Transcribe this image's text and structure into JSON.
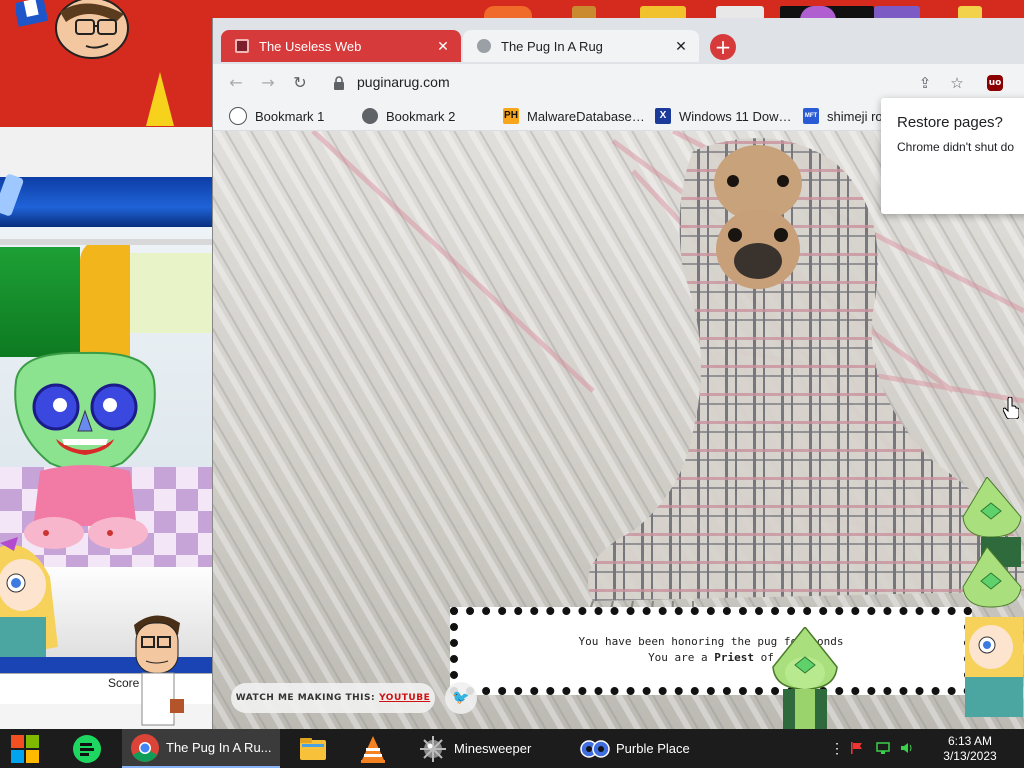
{
  "browser": {
    "tabs": [
      {
        "title": "The Useless Web",
        "active": false
      },
      {
        "title": "The Pug In A Rug",
        "active": true
      }
    ],
    "new_tab_symbol": "+",
    "url": "puginarug.com",
    "bookmarks": [
      {
        "label": "Bookmark 1",
        "icon": "ghost-icon"
      },
      {
        "label": "Bookmark 2",
        "icon": "globe-icon"
      },
      {
        "label": "MalwareDatabase…",
        "icon": "ph-icon",
        "icon_text": "PH"
      },
      {
        "label": "Windows 11 Dow…",
        "icon": "x-icon",
        "icon_text": "X"
      },
      {
        "label": "shimeji ro…",
        "icon": "mft-icon",
        "icon_text": "MFT"
      }
    ],
    "restore_popup": {
      "title": "Restore pages?",
      "body": "Chrome didn't shut do"
    }
  },
  "page": {
    "honor_line1": "You have been honoring the pug fo      econds",
    "honor_line2_prefix": "You are a ",
    "honor_rank": "Priest",
    "honor_line2_suffix": " of",
    "watch_label": "WATCH ME MAKING THIS:",
    "watch_link": "YOUTUBE"
  },
  "game": {
    "score_label": "Score"
  },
  "taskbar": {
    "items": [
      {
        "label": "",
        "icon": "windows-start-icon"
      },
      {
        "label": "",
        "icon": "green-app-icon"
      },
      {
        "label": "The Pug In A Ru...",
        "icon": "chrome-icon",
        "active": true
      },
      {
        "label": "",
        "icon": "file-explorer-icon"
      },
      {
        "label": "",
        "icon": "vlc-icon"
      },
      {
        "label": "Minesweeper",
        "icon": "mine-icon"
      },
      {
        "label": "Purble Place",
        "icon": "eyes-icon"
      }
    ],
    "time": "6:13 AM",
    "date": "3/13/2023"
  },
  "colors": {
    "desktop_red": "#d42b1e",
    "tab_red": "#d73a3a",
    "taskbar": "#1c1c1c"
  }
}
